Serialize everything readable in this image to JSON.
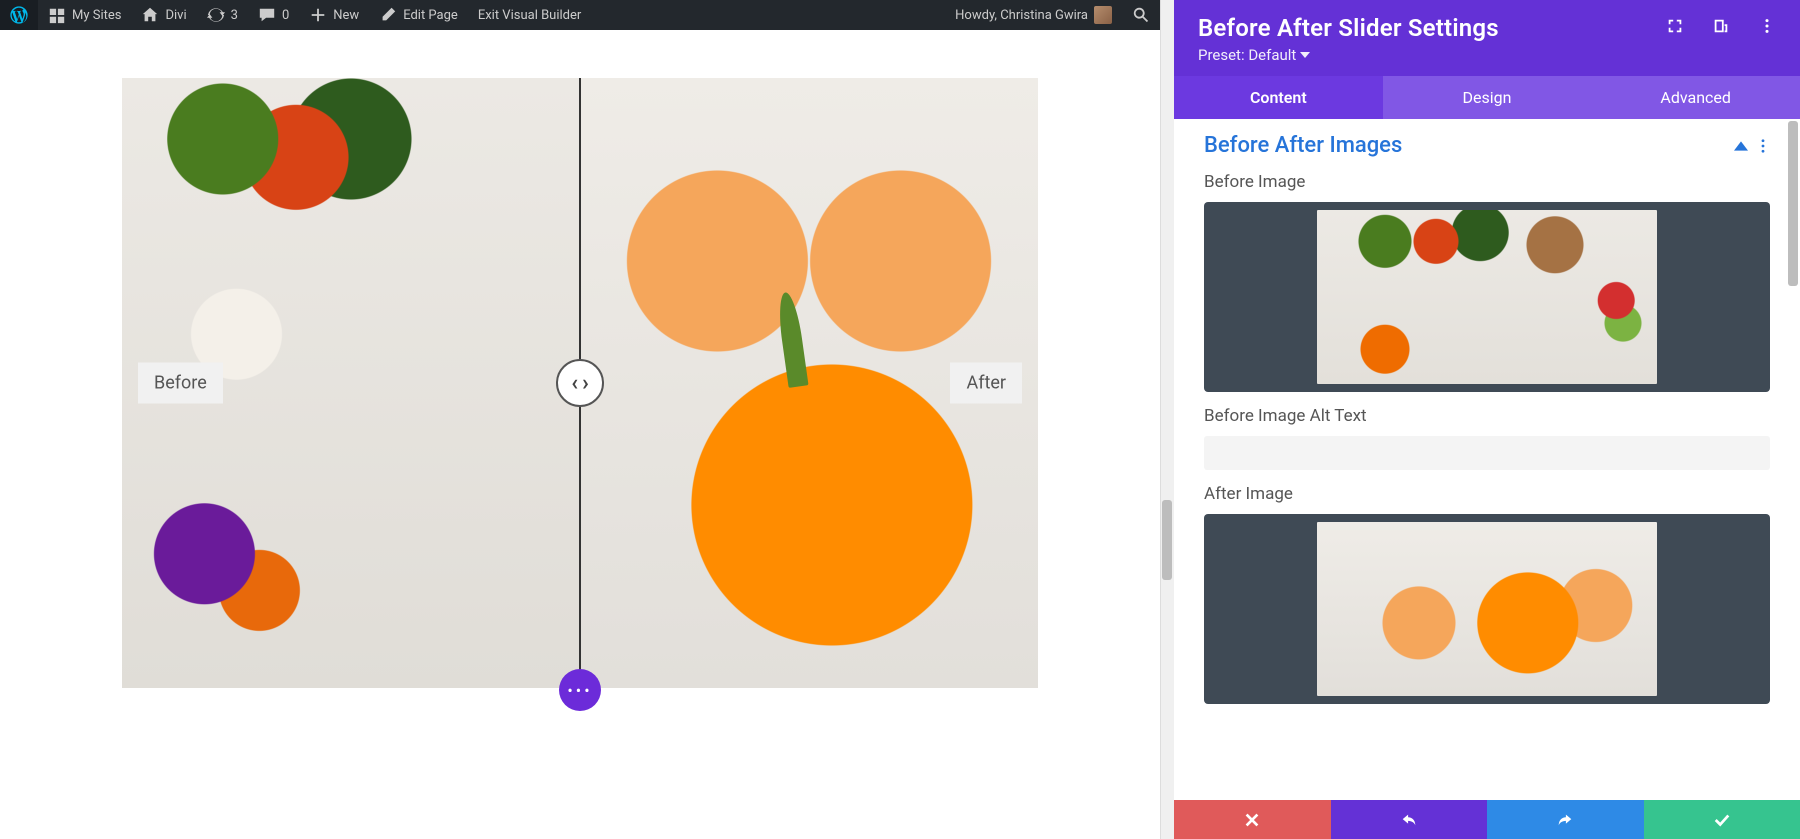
{
  "adminbar": {
    "my_sites": "My Sites",
    "site_name": "Divi",
    "updates": "3",
    "comments": "0",
    "new": "New",
    "edit_page": "Edit Page",
    "exit_vb": "Exit Visual Builder",
    "howdy": "Howdy, Christina Gwira"
  },
  "slider": {
    "before_label": "Before",
    "after_label": "After",
    "fab": "•••"
  },
  "panel": {
    "title": "Before After Slider Settings",
    "preset": "Preset: Default",
    "tabs": {
      "content": "Content",
      "design": "Design",
      "advanced": "Advanced"
    },
    "section": "Before After Images",
    "before_image_label": "Before Image",
    "before_alt_label": "Before Image Alt Text",
    "before_alt_value": "",
    "after_image_label": "After Image"
  }
}
